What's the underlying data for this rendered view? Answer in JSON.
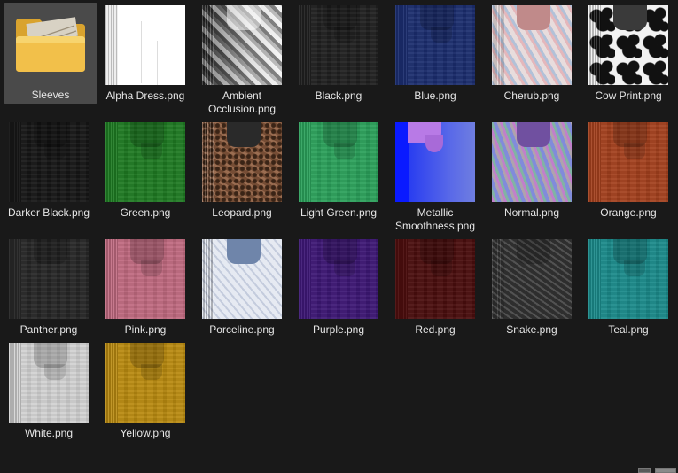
{
  "items": [
    {
      "name": "Sleeves",
      "kind": "folder"
    },
    {
      "name": "Alpha Dress.png",
      "kind": "image",
      "color": "#ffffff"
    },
    {
      "name": "Ambient Occlusion.png",
      "kind": "image",
      "color": "#9a9a9a"
    },
    {
      "name": "Black.png",
      "kind": "image",
      "color": "#1f1f1f"
    },
    {
      "name": "Blue.png",
      "kind": "image",
      "color": "#1b2d6e"
    },
    {
      "name": "Cherub.png",
      "kind": "image",
      "color": "#d8c8c8"
    },
    {
      "name": "Cow Print.png",
      "kind": "image",
      "color": "#e8e8e8"
    },
    {
      "name": "Darker Black.png",
      "kind": "image",
      "color": "#151515"
    },
    {
      "name": "Green.png",
      "kind": "image",
      "color": "#1e7a22"
    },
    {
      "name": "Leopard.png",
      "kind": "image",
      "color": "#8a5a3e"
    },
    {
      "name": "Light Green.png",
      "kind": "image",
      "color": "#2aa05a"
    },
    {
      "name": "Metallic Smoothness.png",
      "kind": "image",
      "color": "#1a2df0"
    },
    {
      "name": "Normal.png",
      "kind": "image",
      "color": "#8a8ad0"
    },
    {
      "name": "Orange.png",
      "kind": "image",
      "color": "#a3401d"
    },
    {
      "name": "Panther.png",
      "kind": "image",
      "color": "#262626"
    },
    {
      "name": "Pink.png",
      "kind": "image",
      "color": "#c06a80"
    },
    {
      "name": "Porceline.png",
      "kind": "image",
      "color": "#dde3ee"
    },
    {
      "name": "Purple.png",
      "kind": "image",
      "color": "#3d1775"
    },
    {
      "name": "Red.png",
      "kind": "image",
      "color": "#4a0d0d"
    },
    {
      "name": "Snake.png",
      "kind": "image",
      "color": "#3a3a3a"
    },
    {
      "name": "Teal.png",
      "kind": "image",
      "color": "#1a8a8a"
    },
    {
      "name": "White.png",
      "kind": "image",
      "color": "#d2d2d2"
    },
    {
      "name": "Yellow.png",
      "kind": "image",
      "color": "#b98a10"
    }
  ],
  "selected_item": "Sleeves",
  "colors": {
    "background": "#191919",
    "selection": "#4a4a4a",
    "label_text": "#e6e6e6",
    "folder_yellow": "#f2c04a"
  }
}
